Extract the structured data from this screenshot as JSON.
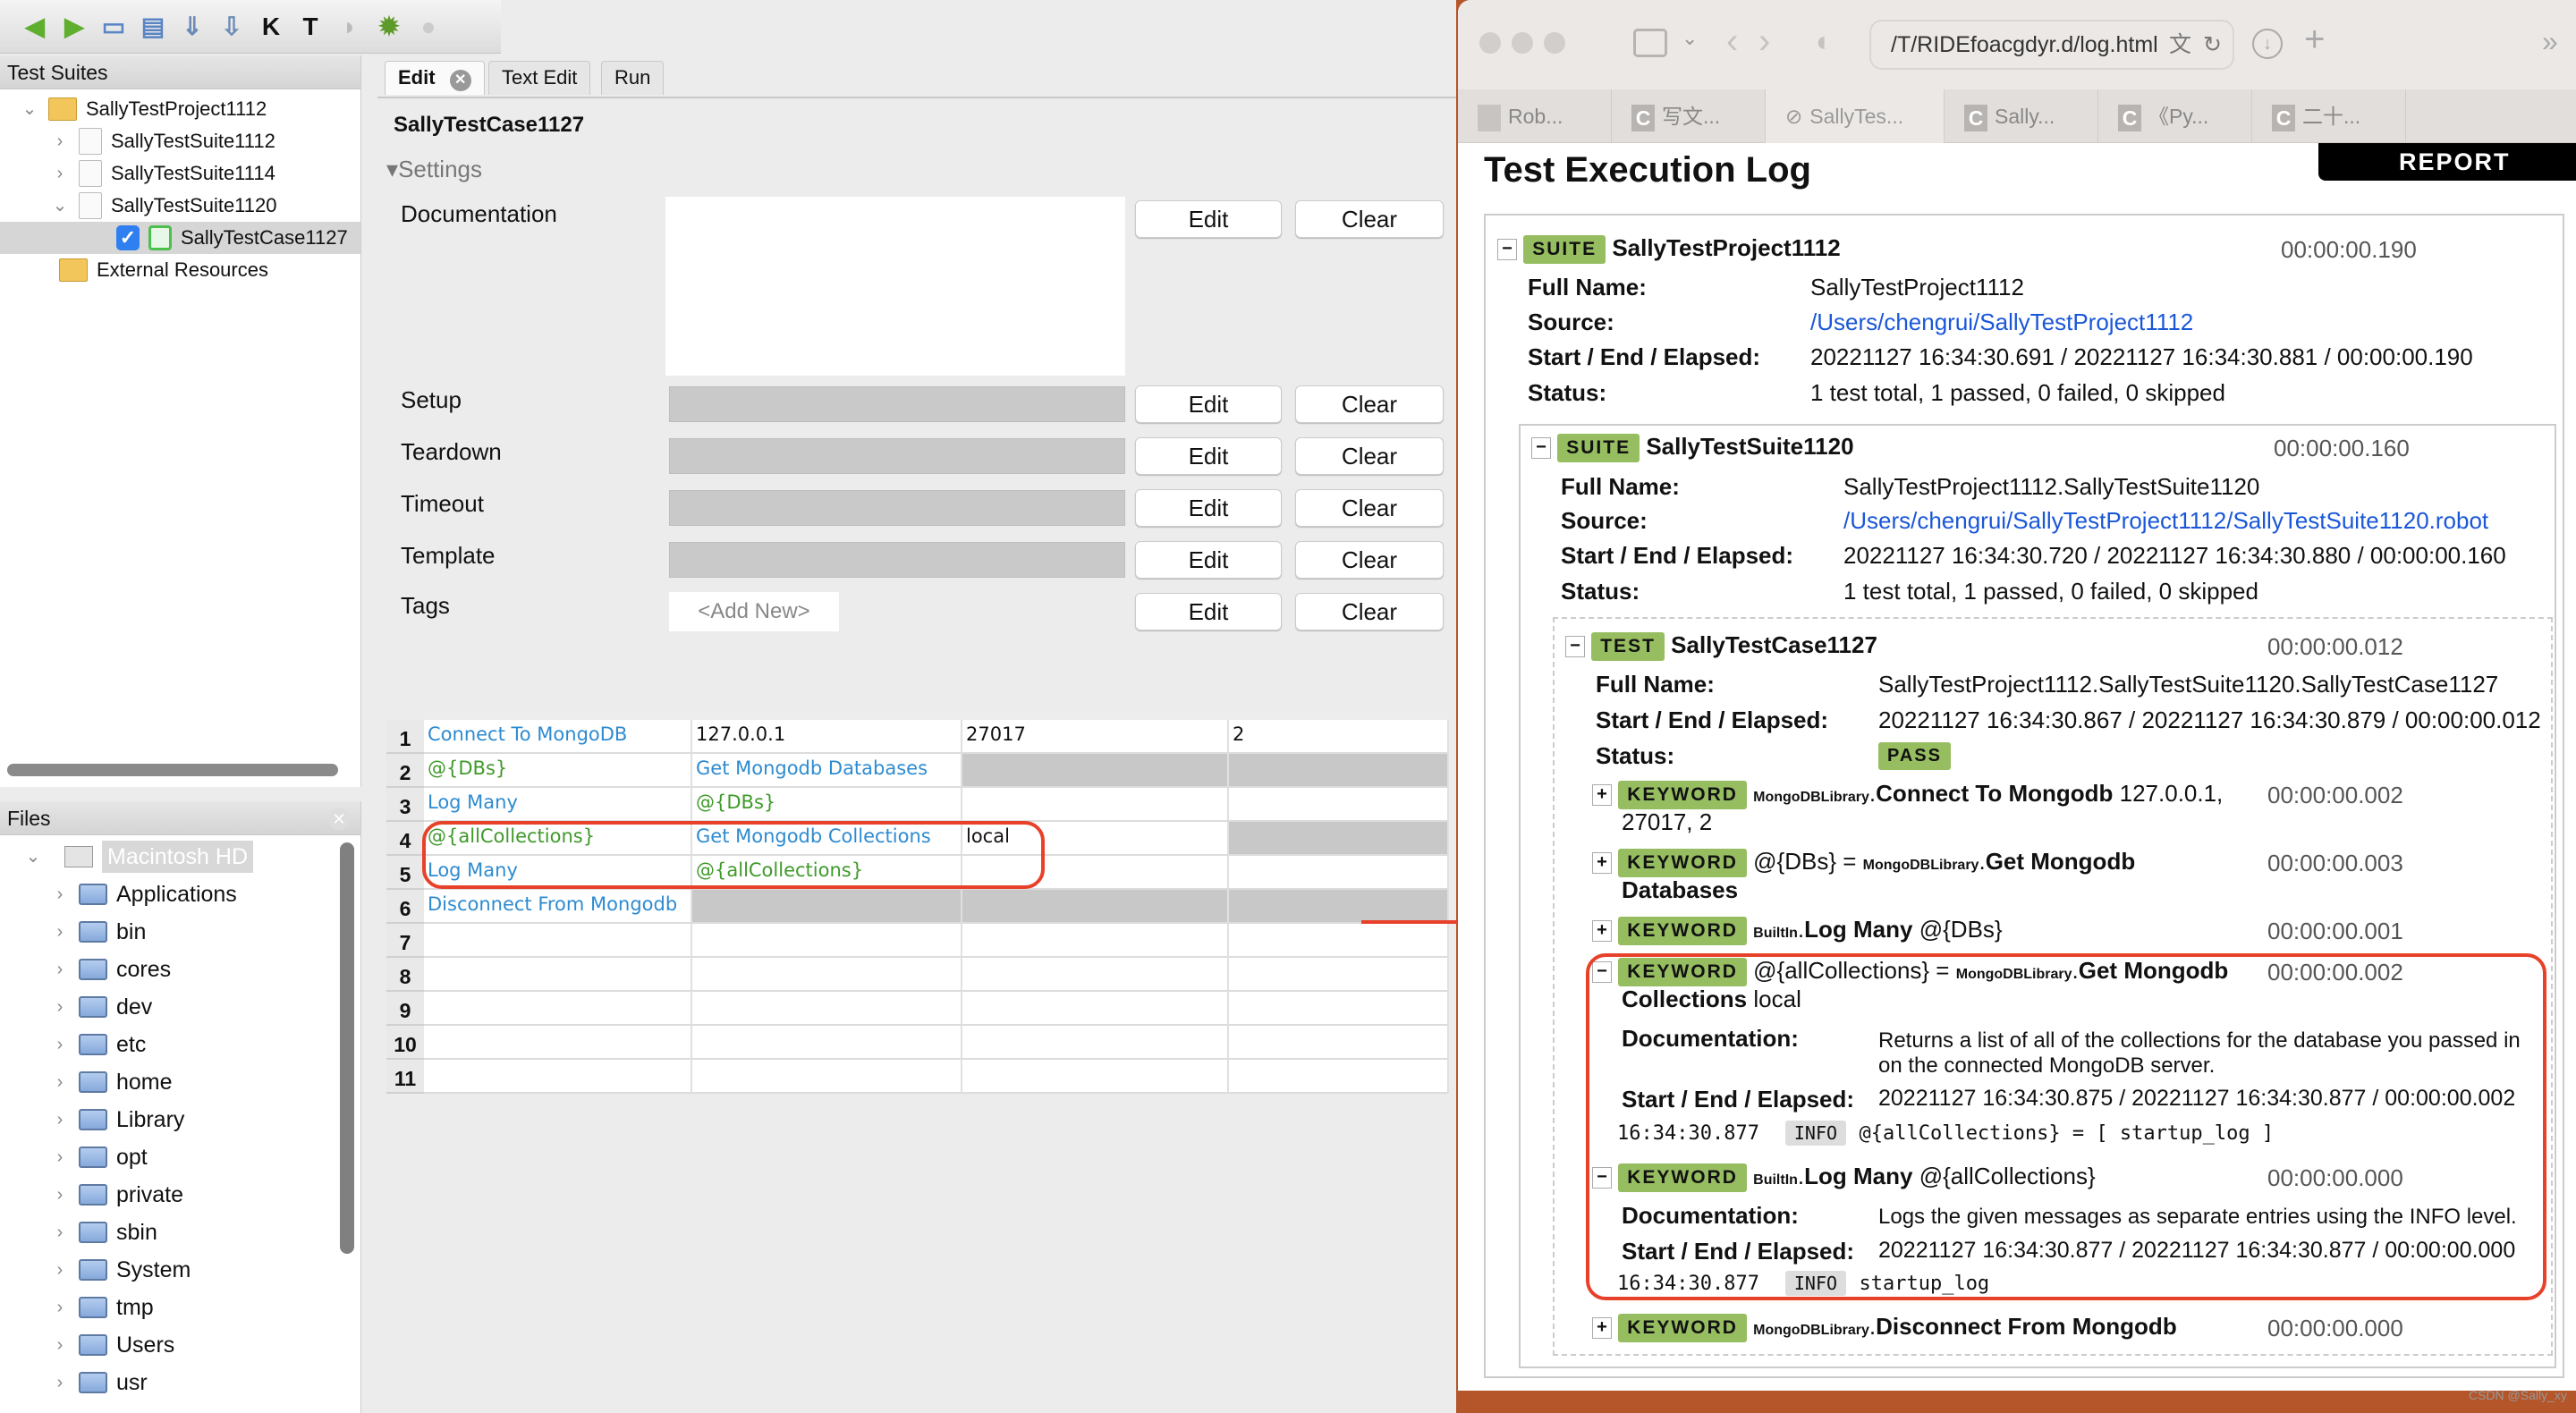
{
  "ride": {
    "toolbar_icons": [
      "back-arrow-icon",
      "forward-arrow-icon",
      "new-project-icon",
      "open-icon",
      "open-directory-icon",
      "save-icon",
      "search-keywords-icon",
      "search-tests-icon",
      "run-icon",
      "debug-bug-icon",
      "stop-icon"
    ],
    "test_suites": {
      "title": "Test Suites",
      "tree": [
        "SallyTestProject1112",
        "SallyTestSuite1112",
        "SallyTestSuite1114",
        "SallyTestSuite1120",
        "SallyTestCase1127",
        "External Resources"
      ]
    },
    "files": {
      "title": "Files",
      "root": "Macintosh HD",
      "items": [
        "Applications",
        "bin",
        "cores",
        "dev",
        "etc",
        "home",
        "Library",
        "opt",
        "private",
        "sbin",
        "System",
        "tmp",
        "Users",
        "usr"
      ]
    },
    "tabs": [
      "Edit",
      "Text Edit",
      "Run"
    ],
    "test_name": "SallyTestCase1127",
    "settings_label": "Settings",
    "settings": [
      {
        "label": "Documentation"
      },
      {
        "label": "Setup"
      },
      {
        "label": "Teardown"
      },
      {
        "label": "Timeout"
      },
      {
        "label": "Template"
      },
      {
        "label": "Tags"
      }
    ],
    "tags_placeholder": "<Add New>",
    "edit_label": "Edit",
    "clear_label": "Clear",
    "grid": [
      [
        {
          "t": "Connect To MongoDB",
          "k": "keyword"
        },
        {
          "t": "127.0.0.1",
          "k": "arg"
        },
        {
          "t": "27017",
          "k": "arg"
        },
        {
          "t": "2",
          "k": "arg"
        }
      ],
      [
        {
          "t": "@{DBs}",
          "k": "variable"
        },
        {
          "t": "Get Mongodb Databases",
          "k": "keyword"
        },
        {
          "t": "",
          "k": "disabled"
        },
        {
          "t": "",
          "k": "disabled"
        }
      ],
      [
        {
          "t": "Log Many",
          "k": "keyword"
        },
        {
          "t": "@{DBs}",
          "k": "variable"
        },
        {
          "t": "",
          "k": "arg"
        },
        {
          "t": "",
          "k": "arg"
        }
      ],
      [
        {
          "t": "@{allCollections}",
          "k": "variable"
        },
        {
          "t": "Get Mongodb Collections",
          "k": "keyword"
        },
        {
          "t": "local",
          "k": "arg"
        },
        {
          "t": "",
          "k": "disabled"
        }
      ],
      [
        {
          "t": "Log Many",
          "k": "keyword"
        },
        {
          "t": "@{allCollections}",
          "k": "variable"
        },
        {
          "t": "",
          "k": "arg"
        },
        {
          "t": "",
          "k": "arg"
        }
      ],
      [
        {
          "t": "Disconnect From Mongodb",
          "k": "keyword"
        },
        {
          "t": "",
          "k": "disabled"
        },
        {
          "t": "",
          "k": "disabled"
        },
        {
          "t": "",
          "k": "disabled"
        }
      ],
      [
        {
          "t": "",
          "k": "arg"
        },
        {
          "t": "",
          "k": "arg"
        },
        {
          "t": "",
          "k": "arg"
        },
        {
          "t": "",
          "k": "arg"
        }
      ],
      [
        {
          "t": "",
          "k": "arg"
        },
        {
          "t": "",
          "k": "arg"
        },
        {
          "t": "",
          "k": "arg"
        },
        {
          "t": "",
          "k": "arg"
        }
      ],
      [
        {
          "t": "",
          "k": "arg"
        },
        {
          "t": "",
          "k": "arg"
        },
        {
          "t": "",
          "k": "arg"
        },
        {
          "t": "",
          "k": "arg"
        }
      ],
      [
        {
          "t": "",
          "k": "arg"
        },
        {
          "t": "",
          "k": "arg"
        },
        {
          "t": "",
          "k": "arg"
        },
        {
          "t": "",
          "k": "arg"
        }
      ],
      [
        {
          "t": "",
          "k": "arg"
        },
        {
          "t": "",
          "k": "arg"
        },
        {
          "t": "",
          "k": "arg"
        },
        {
          "t": "",
          "k": "arg"
        }
      ]
    ]
  },
  "browser": {
    "url": "/T/RIDEfoacgdyr.d/log.html",
    "tabs": [
      {
        "icon": "robot-icon",
        "label": "Rob..."
      },
      {
        "icon": "csdn-icon",
        "label": "写文..."
      },
      {
        "icon": "compass-icon",
        "label": "SallyTes..."
      },
      {
        "icon": "csdn-icon",
        "label": "Sally..."
      },
      {
        "icon": "csdn-icon",
        "label": "《Py..."
      },
      {
        "icon": "csdn-icon",
        "label": "二十..."
      }
    ]
  },
  "log": {
    "title": "Test Execution Log",
    "report_tab": "REPORT",
    "labels": {
      "full_name": "Full Name:",
      "source": "Source:",
      "times": "Start / End / Elapsed:",
      "status": "Status:",
      "doc": "Documentation:"
    },
    "suite": {
      "badge": "SUITE",
      "name": "SallyTestProject1112",
      "elapsed": "00:00:00.190",
      "full_name": "SallyTestProject1112",
      "source": "/Users/chengrui/SallyTestProject1112",
      "times": "20221127 16:34:30.691 / 20221127 16:34:30.881 / 00:00:00.190",
      "status": "1 test total, 1 passed, 0 failed, 0 skipped"
    },
    "subsuite": {
      "badge": "SUITE",
      "name": "SallyTestSuite1120",
      "elapsed": "00:00:00.160",
      "full_name": "SallyTestProject1112.SallyTestSuite1120",
      "source": "/Users/chengrui/SallyTestProject1112/SallyTestSuite1120.robot",
      "times": "20221127 16:34:30.720 / 20221127 16:34:30.880 / 00:00:00.160",
      "status": "1 test total, 1 passed, 0 failed, 0 skipped"
    },
    "test": {
      "badge": "TEST",
      "name": "SallyTestCase1127",
      "elapsed": "00:00:00.012",
      "full_name": "SallyTestProject1112.SallyTestSuite1120.SallyTestCase1127",
      "times": "20221127 16:34:30.867 / 20221127 16:34:30.879 / 00:00:00.012",
      "status": "PASS"
    },
    "keyword_badge": "KEYWORD",
    "keywords": [
      {
        "toggle": "+",
        "assign": "",
        "lib": "MongoDBLibrary",
        "name": "Connect To Mongodb",
        "args": "127.0.0.1,",
        "args2": "27017, 2",
        "elapsed": "00:00:00.002"
      },
      {
        "toggle": "+",
        "assign": "@{DBs} =",
        "lib": "MongoDBLibrary",
        "name": "Get Mongodb",
        "name2": "Databases",
        "elapsed": "00:00:00.003"
      },
      {
        "toggle": "+",
        "assign": "",
        "lib": "BuiltIn",
        "name": "Log Many",
        "args": "@{DBs}",
        "elapsed": "00:00:00.001"
      },
      {
        "toggle": "−",
        "assign": "@{allCollections} =",
        "lib": "MongoDBLibrary",
        "name": "Get Mongodb",
        "name2": "Collections",
        "args2": "local",
        "elapsed": "00:00:00.002",
        "doc": "Returns a list of all of the collections for the database you passed in",
        "doc2": "on the connected MongoDB server.",
        "times": "20221127 16:34:30.875 / 20221127 16:34:30.877 / 00:00:00.002",
        "msg_time": "16:34:30.877",
        "msg_level": "INFO",
        "msg": "@{allCollections} = [ startup_log ]"
      },
      {
        "toggle": "−",
        "assign": "",
        "lib": "BuiltIn",
        "name": "Log Many",
        "args": "@{allCollections}",
        "elapsed": "00:00:00.000",
        "doc": "Logs the given messages as separate entries using the INFO level.",
        "times": "20221127 16:34:30.877 / 20221127 16:34:30.877 / 00:00:00.000",
        "msg_time": "16:34:30.877",
        "msg_level": "INFO",
        "msg": "startup_log"
      },
      {
        "toggle": "+",
        "assign": "",
        "lib": "MongoDBLibrary",
        "name": "Disconnect From Mongodb",
        "elapsed": "00:00:00.000"
      }
    ]
  },
  "watermark": "CSDN @Sally_xy",
  "colors": {
    "keyword_badge": "#97bd61",
    "annotation_red": "#e8412a",
    "ride_keyword": "#2e8bd0",
    "ride_variable": "#3f9a2a",
    "link": "#1a57d8"
  }
}
